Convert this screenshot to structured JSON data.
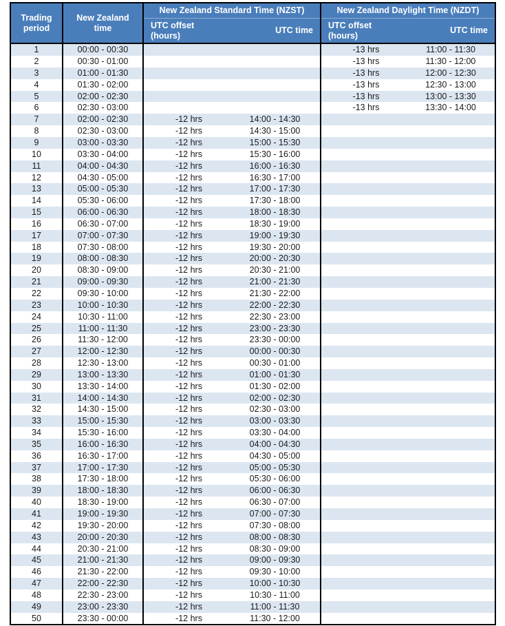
{
  "table": {
    "headers": {
      "trading_period": {
        "line1": "Trading",
        "line2": "period"
      },
      "nz_time": {
        "line1": "New Zealand",
        "line2": "time"
      },
      "nzst_group": "New Zealand Standard Time (NZST)",
      "nzdt_group": "New Zealand Daylight Time (NZDT)",
      "nzst_offset": "UTC offset (hours)",
      "nzst_utc": "UTC time",
      "nzdt_offset": "UTC offset (hours)",
      "nzdt_utc": "UTC time"
    },
    "colors": {
      "header_blue": "#4a7ebb",
      "header_text": "#ffffff",
      "stripe_blue": "#dce6f1",
      "stripe_white": "#ffffff",
      "border": "#000000",
      "body_text": "#1a1a1a"
    },
    "rows": [
      {
        "period": "1",
        "nz_time": "00:00 - 00:30",
        "nzst_offset": "",
        "nzst_utc": "",
        "nzdt_offset": "-13 hrs",
        "nzdt_utc": "11:00 - 11:30"
      },
      {
        "period": "2",
        "nz_time": "00:30 - 01:00",
        "nzst_offset": "",
        "nzst_utc": "",
        "nzdt_offset": "-13 hrs",
        "nzdt_utc": "11:30 - 12:00"
      },
      {
        "period": "3",
        "nz_time": "01:00 - 01:30",
        "nzst_offset": "",
        "nzst_utc": "",
        "nzdt_offset": "-13 hrs",
        "nzdt_utc": "12:00 - 12:30"
      },
      {
        "period": "4",
        "nz_time": "01:30 - 02:00",
        "nzst_offset": "",
        "nzst_utc": "",
        "nzdt_offset": "-13 hrs",
        "nzdt_utc": "12:30 - 13:00"
      },
      {
        "period": "5",
        "nz_time": "02:00 - 02:30",
        "nzst_offset": "",
        "nzst_utc": "",
        "nzdt_offset": "-13 hrs",
        "nzdt_utc": "13:00 - 13:30"
      },
      {
        "period": "6",
        "nz_time": "02:30 - 03:00",
        "nzst_offset": "",
        "nzst_utc": "",
        "nzdt_offset": "-13 hrs",
        "nzdt_utc": "13:30 - 14:00"
      },
      {
        "period": "7",
        "nz_time": "02:00 - 02:30",
        "nzst_offset": "-12 hrs",
        "nzst_utc": "14:00 - 14:30",
        "nzdt_offset": "",
        "nzdt_utc": ""
      },
      {
        "period": "8",
        "nz_time": "02:30 - 03:00",
        "nzst_offset": "-12 hrs",
        "nzst_utc": "14:30 - 15:00",
        "nzdt_offset": "",
        "nzdt_utc": ""
      },
      {
        "period": "9",
        "nz_time": "03:00 - 03:30",
        "nzst_offset": "-12 hrs",
        "nzst_utc": "15:00 - 15:30",
        "nzdt_offset": "",
        "nzdt_utc": ""
      },
      {
        "period": "10",
        "nz_time": "03:30 - 04:00",
        "nzst_offset": "-12 hrs",
        "nzst_utc": "15:30 - 16:00",
        "nzdt_offset": "",
        "nzdt_utc": ""
      },
      {
        "period": "11",
        "nz_time": "04:00 - 04:30",
        "nzst_offset": "-12 hrs",
        "nzst_utc": "16:00 - 16:30",
        "nzdt_offset": "",
        "nzdt_utc": ""
      },
      {
        "period": "12",
        "nz_time": "04:30 - 05:00",
        "nzst_offset": "-12 hrs",
        "nzst_utc": "16:30 - 17:00",
        "nzdt_offset": "",
        "nzdt_utc": ""
      },
      {
        "period": "13",
        "nz_time": "05:00 - 05:30",
        "nzst_offset": "-12 hrs",
        "nzst_utc": "17:00 - 17:30",
        "nzdt_offset": "",
        "nzdt_utc": ""
      },
      {
        "period": "14",
        "nz_time": "05:30 - 06:00",
        "nzst_offset": "-12 hrs",
        "nzst_utc": "17:30 - 18:00",
        "nzdt_offset": "",
        "nzdt_utc": ""
      },
      {
        "period": "15",
        "nz_time": "06:00 - 06:30",
        "nzst_offset": "-12 hrs",
        "nzst_utc": "18:00 - 18:30",
        "nzdt_offset": "",
        "nzdt_utc": ""
      },
      {
        "period": "16",
        "nz_time": "06:30 - 07:00",
        "nzst_offset": "-12 hrs",
        "nzst_utc": "18:30 - 19:00",
        "nzdt_offset": "",
        "nzdt_utc": ""
      },
      {
        "period": "17",
        "nz_time": "07:00 - 07:30",
        "nzst_offset": "-12 hrs",
        "nzst_utc": "19:00 - 19:30",
        "nzdt_offset": "",
        "nzdt_utc": ""
      },
      {
        "period": "18",
        "nz_time": "07:30 - 08:00",
        "nzst_offset": "-12 hrs",
        "nzst_utc": "19:30 - 20:00",
        "nzdt_offset": "",
        "nzdt_utc": ""
      },
      {
        "period": "19",
        "nz_time": "08:00 - 08:30",
        "nzst_offset": "-12 hrs",
        "nzst_utc": "20:00 - 20:30",
        "nzdt_offset": "",
        "nzdt_utc": ""
      },
      {
        "period": "20",
        "nz_time": "08:30 - 09:00",
        "nzst_offset": "-12 hrs",
        "nzst_utc": "20:30 - 21:00",
        "nzdt_offset": "",
        "nzdt_utc": ""
      },
      {
        "period": "21",
        "nz_time": "09:00 - 09:30",
        "nzst_offset": "-12 hrs",
        "nzst_utc": "21:00 - 21:30",
        "nzdt_offset": "",
        "nzdt_utc": ""
      },
      {
        "period": "22",
        "nz_time": "09:30 - 10:00",
        "nzst_offset": "-12 hrs",
        "nzst_utc": "21:30 - 22:00",
        "nzdt_offset": "",
        "nzdt_utc": ""
      },
      {
        "period": "23",
        "nz_time": "10:00 - 10:30",
        "nzst_offset": "-12 hrs",
        "nzst_utc": "22:00 - 22:30",
        "nzdt_offset": "",
        "nzdt_utc": ""
      },
      {
        "period": "24",
        "nz_time": "10:30 - 11:00",
        "nzst_offset": "-12 hrs",
        "nzst_utc": "22:30 - 23:00",
        "nzdt_offset": "",
        "nzdt_utc": ""
      },
      {
        "period": "25",
        "nz_time": "11:00 - 11:30",
        "nzst_offset": "-12 hrs",
        "nzst_utc": "23:00 - 23:30",
        "nzdt_offset": "",
        "nzdt_utc": ""
      },
      {
        "period": "26",
        "nz_time": "11:30 - 12:00",
        "nzst_offset": "-12 hrs",
        "nzst_utc": "23:30 - 00:00",
        "nzdt_offset": "",
        "nzdt_utc": ""
      },
      {
        "period": "27",
        "nz_time": "12:00 - 12:30",
        "nzst_offset": "-12 hrs",
        "nzst_utc": "00:00 - 00:30",
        "nzdt_offset": "",
        "nzdt_utc": ""
      },
      {
        "period": "28",
        "nz_time": "12:30 - 13:00",
        "nzst_offset": "-12 hrs",
        "nzst_utc": "00:30 - 01:00",
        "nzdt_offset": "",
        "nzdt_utc": ""
      },
      {
        "period": "29",
        "nz_time": "13:00 - 13:30",
        "nzst_offset": "-12 hrs",
        "nzst_utc": "01:00 - 01:30",
        "nzdt_offset": "",
        "nzdt_utc": ""
      },
      {
        "period": "30",
        "nz_time": "13:30 - 14:00",
        "nzst_offset": "-12 hrs",
        "nzst_utc": "01:30 - 02:00",
        "nzdt_offset": "",
        "nzdt_utc": ""
      },
      {
        "period": "31",
        "nz_time": "14:00 - 14:30",
        "nzst_offset": "-12 hrs",
        "nzst_utc": "02:00 - 02:30",
        "nzdt_offset": "",
        "nzdt_utc": ""
      },
      {
        "period": "32",
        "nz_time": "14:30 - 15:00",
        "nzst_offset": "-12 hrs",
        "nzst_utc": "02:30 - 03:00",
        "nzdt_offset": "",
        "nzdt_utc": ""
      },
      {
        "period": "33",
        "nz_time": "15:00 - 15:30",
        "nzst_offset": "-12 hrs",
        "nzst_utc": "03:00 - 03:30",
        "nzdt_offset": "",
        "nzdt_utc": ""
      },
      {
        "period": "34",
        "nz_time": "15:30 - 16:00",
        "nzst_offset": "-12 hrs",
        "nzst_utc": "03:30 - 04:00",
        "nzdt_offset": "",
        "nzdt_utc": ""
      },
      {
        "period": "35",
        "nz_time": "16:00 - 16:30",
        "nzst_offset": "-12 hrs",
        "nzst_utc": "04:00 - 04:30",
        "nzdt_offset": "",
        "nzdt_utc": ""
      },
      {
        "period": "36",
        "nz_time": "16:30 - 17:00",
        "nzst_offset": "-12 hrs",
        "nzst_utc": "04:30 - 05:00",
        "nzdt_offset": "",
        "nzdt_utc": ""
      },
      {
        "period": "37",
        "nz_time": "17:00 - 17:30",
        "nzst_offset": "-12 hrs",
        "nzst_utc": "05:00 - 05:30",
        "nzdt_offset": "",
        "nzdt_utc": ""
      },
      {
        "period": "38",
        "nz_time": "17:30 - 18:00",
        "nzst_offset": "-12 hrs",
        "nzst_utc": "05:30 - 06:00",
        "nzdt_offset": "",
        "nzdt_utc": ""
      },
      {
        "period": "39",
        "nz_time": "18:00 - 18:30",
        "nzst_offset": "-12 hrs",
        "nzst_utc": "06:00 - 06:30",
        "nzdt_offset": "",
        "nzdt_utc": ""
      },
      {
        "period": "40",
        "nz_time": "18:30 - 19:00",
        "nzst_offset": "-12 hrs",
        "nzst_utc": "06:30 - 07:00",
        "nzdt_offset": "",
        "nzdt_utc": ""
      },
      {
        "period": "41",
        "nz_time": "19:00 - 19:30",
        "nzst_offset": "-12 hrs",
        "nzst_utc": "07:00 - 07:30",
        "nzdt_offset": "",
        "nzdt_utc": ""
      },
      {
        "period": "42",
        "nz_time": "19:30 - 20:00",
        "nzst_offset": "-12 hrs",
        "nzst_utc": "07:30 - 08:00",
        "nzdt_offset": "",
        "nzdt_utc": ""
      },
      {
        "period": "43",
        "nz_time": "20:00 - 20:30",
        "nzst_offset": "-12 hrs",
        "nzst_utc": "08:00 - 08:30",
        "nzdt_offset": "",
        "nzdt_utc": ""
      },
      {
        "period": "44",
        "nz_time": "20:30 - 21:00",
        "nzst_offset": "-12 hrs",
        "nzst_utc": "08:30 - 09:00",
        "nzdt_offset": "",
        "nzdt_utc": ""
      },
      {
        "period": "45",
        "nz_time": "21:00 - 21:30",
        "nzst_offset": "-12 hrs",
        "nzst_utc": "09:00 - 09:30",
        "nzdt_offset": "",
        "nzdt_utc": ""
      },
      {
        "period": "46",
        "nz_time": "21:30 - 22:00",
        "nzst_offset": "-12 hrs",
        "nzst_utc": "09:30 - 10:00",
        "nzdt_offset": "",
        "nzdt_utc": ""
      },
      {
        "period": "47",
        "nz_time": "22:00 - 22:30",
        "nzst_offset": "-12 hrs",
        "nzst_utc": "10:00 - 10:30",
        "nzdt_offset": "",
        "nzdt_utc": ""
      },
      {
        "period": "48",
        "nz_time": "22:30 - 23:00",
        "nzst_offset": "-12 hrs",
        "nzst_utc": "10:30 - 11:00",
        "nzdt_offset": "",
        "nzdt_utc": ""
      },
      {
        "period": "49",
        "nz_time": "23:00 - 23:30",
        "nzst_offset": "-12 hrs",
        "nzst_utc": "11:00 - 11:30",
        "nzdt_offset": "",
        "nzdt_utc": ""
      },
      {
        "period": "50",
        "nz_time": "23:30 - 00:00",
        "nzst_offset": "-12 hrs",
        "nzst_utc": "11:30 - 12:00",
        "nzdt_offset": "",
        "nzdt_utc": ""
      }
    ]
  }
}
